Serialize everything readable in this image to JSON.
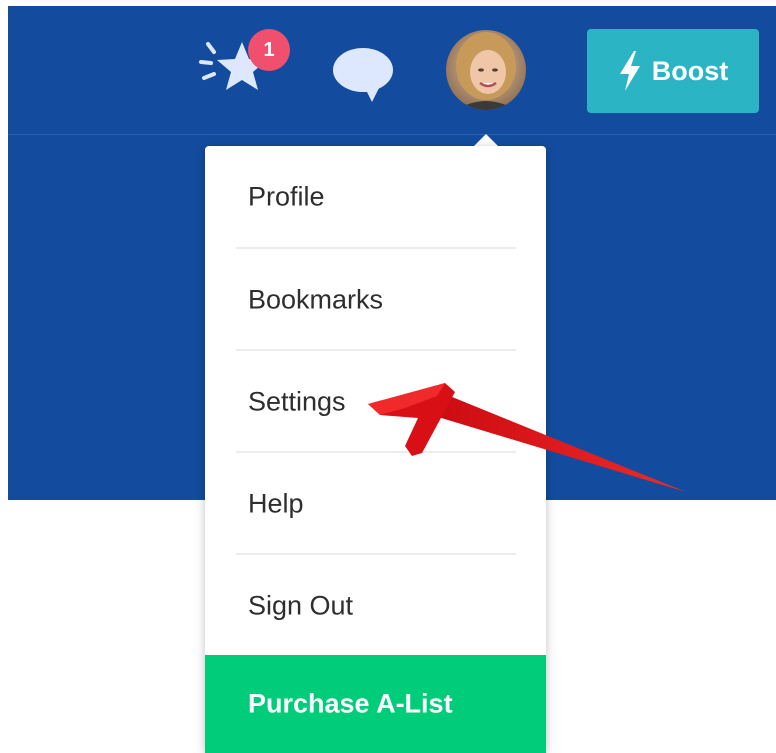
{
  "header": {
    "notifications": {
      "icon": "star-burst-icon",
      "badge_count": "1"
    },
    "messages": {
      "icon": "chat-bubble-icon"
    },
    "avatar": {
      "icon": "user-avatar"
    },
    "boost": {
      "icon": "lightning-icon",
      "label": "Boost"
    }
  },
  "dropdown": {
    "items": [
      {
        "label": "Profile"
      },
      {
        "label": "Bookmarks"
      },
      {
        "label": "Settings"
      },
      {
        "label": "Help"
      },
      {
        "label": "Sign Out"
      }
    ],
    "cta": {
      "label": "Purchase A-List"
    }
  },
  "annotation": {
    "type": "arrow-pointing-to-settings"
  },
  "colors": {
    "header_bg": "#134c9e",
    "badge": "#f0506e",
    "boost": "#2bb5c4",
    "cta": "#00cc7a",
    "arrow": "#e0141c",
    "icon": "#dde8ff"
  }
}
